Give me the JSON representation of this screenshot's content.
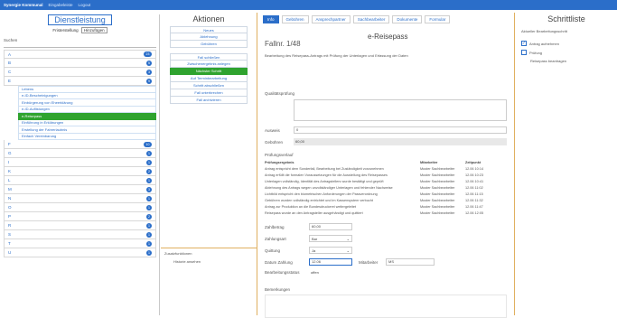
{
  "topbar": {
    "brand": "Synergie Kommunal",
    "links": [
      "Eingabeleiste",
      "Logout"
    ]
  },
  "left": {
    "title": "Dienstleistung",
    "filter_label": "Fristerstellung",
    "filter_button": "Hinzufügen",
    "search_placeholder": "Suchen",
    "groups_top": [
      {
        "letter": "A",
        "count": "23"
      },
      {
        "letter": "B",
        "count": "5"
      },
      {
        "letter": "C",
        "count": "3"
      },
      {
        "letter": "E",
        "count": "9"
      }
    ],
    "sub_items": [
      "Lebens",
      "e-ID-Bescheinigungen",
      "Einbürgerung von Eheerklärung",
      "e-ID-Auflistungen",
      "e-Reisepass",
      "Einführung in Erklärungen",
      "Erstellung der Fahrerlaubnis",
      "Einfach Vereinbarung"
    ],
    "active_sub": "e-Reisepass",
    "groups_bottom": [
      {
        "letter": "F",
        "count": "10"
      },
      {
        "letter": "G",
        "count": "1"
      },
      {
        "letter": "I",
        "count": "1"
      },
      {
        "letter": "K",
        "count": "2"
      },
      {
        "letter": "L",
        "count": "1"
      },
      {
        "letter": "M",
        "count": "3"
      },
      {
        "letter": "N",
        "count": "1"
      },
      {
        "letter": "O",
        "count": "1"
      },
      {
        "letter": "P",
        "count": "2"
      },
      {
        "letter": "R",
        "count": "1"
      },
      {
        "letter": "S",
        "count": "1"
      },
      {
        "letter": "T",
        "count": "1"
      },
      {
        "letter": "U",
        "count": "1"
      }
    ]
  },
  "actions": {
    "title": "Aktionen",
    "group1": [
      "Neues",
      "Ablehnung",
      "Gebühren"
    ],
    "group2": [
      "Fall schließen",
      "Zwischenergebnis anlegen",
      "Nächster Schritt",
      "Auf Terminbearbeitung",
      "Schritt abschließen",
      "Fall unterbrechen",
      "Fall archivieren"
    ],
    "active": "Nächster Schritt",
    "lower_title": "Zusatzfunktionen",
    "lower_item": "Historie ansehen"
  },
  "main": {
    "tabs": [
      "Info",
      "Gebühren",
      "Ansprechpartner",
      "Sachbearbeiter",
      "Dokumente",
      "Formular"
    ],
    "active_tab": "Info",
    "case_number": "Fallnr. 1/48",
    "title": "e-Reisepass",
    "description": "Bearbeitung des Reisepass-Antrags mit Prüfung der Unterlagen und Erfassung der Daten",
    "quality_label": "Qualitätsprüfung",
    "fields": {
      "label1": "Ausweis",
      "value1": "0",
      "label2": "Gebühren",
      "value2": "60,00"
    },
    "table_title": "Prüfungsverlauf",
    "table_headers": [
      "Prüfungsergebnis",
      "Mitarbeiter",
      "Zeitpunkt"
    ],
    "table_rows": [
      [
        "Antrag entspricht dem Sonderfall, Bearbeitung bei Zuständigkeit vorzunehmen",
        "Muster Sachbearbeiter",
        "12.06 10:14"
      ],
      [
        "Antrag erfüllt die formalen Voraussetzungen für die Ausstellung des Reisepasses",
        "Muster Sachbearbeiter",
        "12.06 10:23"
      ],
      [
        "Unterlagen vollständig, Identität des Antragstellers wurde bestätigt und geprüft",
        "Muster Sachbearbeiter",
        "12.06 10:41"
      ],
      [
        "Ablehnung des Antrags wegen unvollständiger Unterlagen und fehlender Nachweise",
        "Muster Sachbearbeiter",
        "12.06 11:02"
      ],
      [
        "Lichtbild entspricht den biometrischen Anforderungen der Passverordnung",
        "Muster Sachbearbeiter",
        "12.06 11:15"
      ],
      [
        "Gebühren wurden vollständig entrichtet und im Kassensystem verbucht",
        "Muster Sachbearbeiter",
        "12.06 11:32"
      ],
      [
        "Antrag zur Produktion an die Bundesdruckerei weitergeleitet",
        "Muster Sachbearbeiter",
        "12.06 11:47"
      ],
      [
        "Reisepass wurde an den Antragsteller ausgehändigt und quittiert",
        "Muster Sachbearbeiter",
        "12.06 12:05"
      ]
    ],
    "form": {
      "amount_label": "Zahlbetrag",
      "amount_value": "60,00",
      "payment_label": "Zahlungsart",
      "payment_value": "Bar",
      "receipt_label": "Quittung",
      "receipt_value": "Ja",
      "date_label": "Datum Zahlung",
      "date_value": "12.06",
      "signature_label": "Mitarbeiter",
      "signature_value": "MS",
      "status_label": "Bearbeitungsstatus",
      "status_value": "offen",
      "remark_label": "Bemerkungen"
    }
  },
  "steps": {
    "title": "Schrittliste",
    "description": "Aktueller Bearbeitungsschritt",
    "items": [
      {
        "label": "Antrag aufnehmen",
        "checked": true
      },
      {
        "label": "Prüfung",
        "checked": false
      }
    ],
    "subitem": "Reisepass beantragen"
  }
}
